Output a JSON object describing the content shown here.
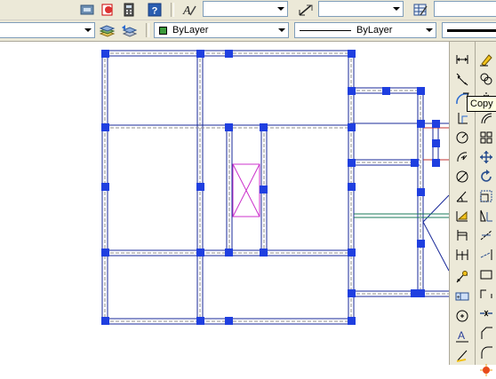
{
  "toolbar_top": {
    "text_style_value": "",
    "dim_style_value": ""
  },
  "properties_bar": {
    "color_value": "ByLayer",
    "linetype_value": "ByLayer"
  },
  "tooltip": {
    "text": "Copy"
  }
}
